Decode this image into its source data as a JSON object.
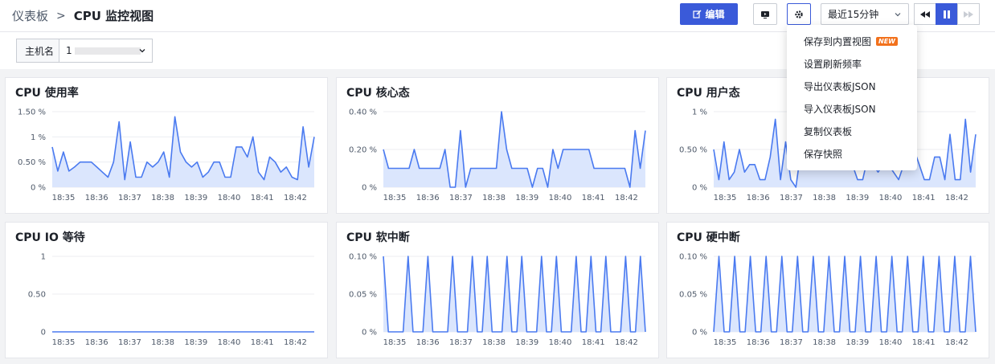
{
  "header": {
    "breadcrumb_root": "仪表板",
    "breadcrumb_sep": ">",
    "title": "CPU 监控视图",
    "edit_label": "编辑",
    "time_range": "最近15分钟"
  },
  "filter": {
    "host_label": "主机名",
    "host_value": "1"
  },
  "settings_menu": {
    "items": [
      "保存到内置视图",
      "设置刷新频率",
      "导出仪表板JSON",
      "导入仪表板JSON",
      "复制仪表板",
      "保存快照"
    ],
    "new_badge": "NEW"
  },
  "colors": {
    "accent": "#3a5ad9",
    "line": "#4a7af0",
    "fill": "#dbe6fd"
  },
  "x_ticks": [
    "18:35",
    "18:36",
    "18:37",
    "18:38",
    "18:39",
    "18:40",
    "18:41",
    "18:42"
  ],
  "chart_data": [
    {
      "type": "area",
      "title": "CPU 使用率",
      "yticks": [
        "1.50 %",
        "1 %",
        "0.50 %",
        "0 %"
      ],
      "ylim": [
        0,
        1.5
      ],
      "values": [
        0.8,
        0.32,
        0.7,
        0.32,
        0.4,
        0.5,
        0.5,
        0.5,
        0.4,
        0.3,
        0.2,
        0.5,
        1.3,
        0.15,
        0.9,
        0.2,
        0.2,
        0.5,
        0.4,
        0.5,
        0.7,
        0.2,
        1.4,
        0.7,
        0.5,
        0.4,
        0.5,
        0.2,
        0.3,
        0.5,
        0.5,
        0.2,
        0.2,
        0.8,
        0.8,
        0.6,
        1.0,
        0.3,
        0.15,
        0.6,
        0.5,
        0.3,
        0.4,
        0.2,
        0.15,
        1.2,
        0.4,
        1.0
      ]
    },
    {
      "type": "area",
      "title": "CPU 核心态",
      "yticks": [
        "0.40 %",
        "0.20 %",
        "0 %"
      ],
      "ylim": [
        0,
        0.4
      ],
      "values": [
        0.2,
        0.1,
        0.1,
        0.1,
        0.1,
        0.1,
        0.2,
        0.1,
        0.1,
        0.1,
        0.1,
        0.1,
        0.2,
        0.0,
        0.0,
        0.3,
        0.0,
        0.1,
        0.1,
        0.1,
        0.1,
        0.1,
        0.1,
        0.4,
        0.2,
        0.1,
        0.1,
        0.1,
        0.1,
        0.0,
        0.1,
        0.1,
        0.0,
        0.2,
        0.1,
        0.2,
        0.2,
        0.2,
        0.2,
        0.2,
        0.2,
        0.1,
        0.1,
        0.1,
        0.1,
        0.1,
        0.1,
        0.1,
        0.0,
        0.3,
        0.1,
        0.3
      ]
    },
    {
      "type": "area",
      "title": "CPU 用户态",
      "yticks": [
        "1 %",
        "0.50 %",
        "0 %"
      ],
      "ylim": [
        0,
        1.0
      ],
      "values": [
        0.5,
        0.1,
        0.6,
        0.1,
        0.2,
        0.5,
        0.2,
        0.3,
        0.3,
        0.1,
        0.1,
        0.4,
        0.9,
        0.1,
        0.6,
        0.1,
        0.0,
        0.5,
        0.3,
        0.5,
        0.3,
        0.3,
        0.5,
        0.4,
        0.3,
        0.4,
        0.3,
        0.3,
        0.1,
        0.1,
        0.4,
        0.3,
        0.2,
        0.3,
        0.3,
        0.2,
        0.1,
        0.3,
        0.3,
        0.5,
        0.3,
        0.1,
        0.1,
        0.4,
        0.4,
        0.1,
        0.7,
        0.1,
        0.1,
        0.9,
        0.2,
        0.7
      ]
    },
    {
      "type": "line",
      "title": "CPU IO 等待",
      "yticks": [
        "1",
        "0.50",
        "0"
      ],
      "ylim": [
        0,
        1
      ],
      "values": [
        0,
        0,
        0,
        0,
        0,
        0,
        0,
        0,
        0,
        0,
        0,
        0,
        0,
        0,
        0,
        0,
        0,
        0,
        0,
        0,
        0,
        0,
        0,
        0,
        0,
        0,
        0,
        0,
        0,
        0,
        0,
        0,
        0,
        0,
        0,
        0,
        0,
        0,
        0,
        0,
        0,
        0,
        0,
        0,
        0,
        0,
        0,
        0
      ]
    },
    {
      "type": "area",
      "title": "CPU 软中断",
      "yticks": [
        "0.10 %",
        "0.05 %",
        "0 %"
      ],
      "ylim": [
        0,
        0.1
      ],
      "values": [
        0.1,
        0,
        0,
        0,
        0,
        0.1,
        0,
        0,
        0,
        0.1,
        0,
        0,
        0,
        0,
        0.1,
        0,
        0,
        0,
        0.1,
        0,
        0,
        0.1,
        0,
        0,
        0,
        0.1,
        0,
        0,
        0.1,
        0,
        0,
        0,
        0.1,
        0,
        0,
        0.1,
        0,
        0,
        0,
        0.1,
        0,
        0,
        0.1,
        0,
        0,
        0.1,
        0,
        0,
        0,
        0.1,
        0,
        0,
        0.1,
        0
      ]
    },
    {
      "type": "area",
      "title": "CPU 硬中断",
      "yticks": [
        "0.10 %",
        "0.05 %",
        "0 %"
      ],
      "ylim": [
        0,
        0.1
      ],
      "values": [
        0,
        0.1,
        0,
        0,
        0.1,
        0,
        0,
        0.1,
        0,
        0,
        0.1,
        0,
        0,
        0.1,
        0,
        0,
        0.1,
        0,
        0,
        0.1,
        0,
        0,
        0.1,
        0,
        0,
        0.1,
        0,
        0,
        0.1,
        0,
        0,
        0.1,
        0,
        0,
        0.1,
        0,
        0,
        0.1,
        0,
        0,
        0.1,
        0,
        0,
        0.1,
        0,
        0,
        0.1,
        0,
        0,
        0.1,
        0
      ]
    }
  ]
}
